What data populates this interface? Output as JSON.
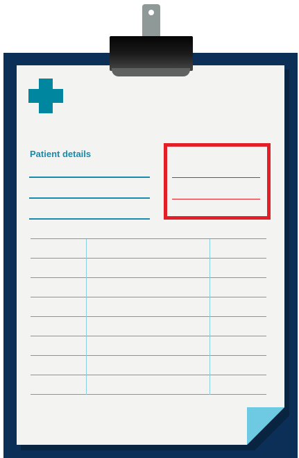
{
  "form": {
    "section_title": "Patient details"
  },
  "colors": {
    "board": "#0b2f57",
    "paper": "#f3f4f2",
    "accent_teal": "#00869e",
    "label_blue": "#1a8aab",
    "highlight_red": "#e21e26",
    "page_curl": "#6ec9e2"
  },
  "icons": [
    "medical-cross-icon"
  ]
}
